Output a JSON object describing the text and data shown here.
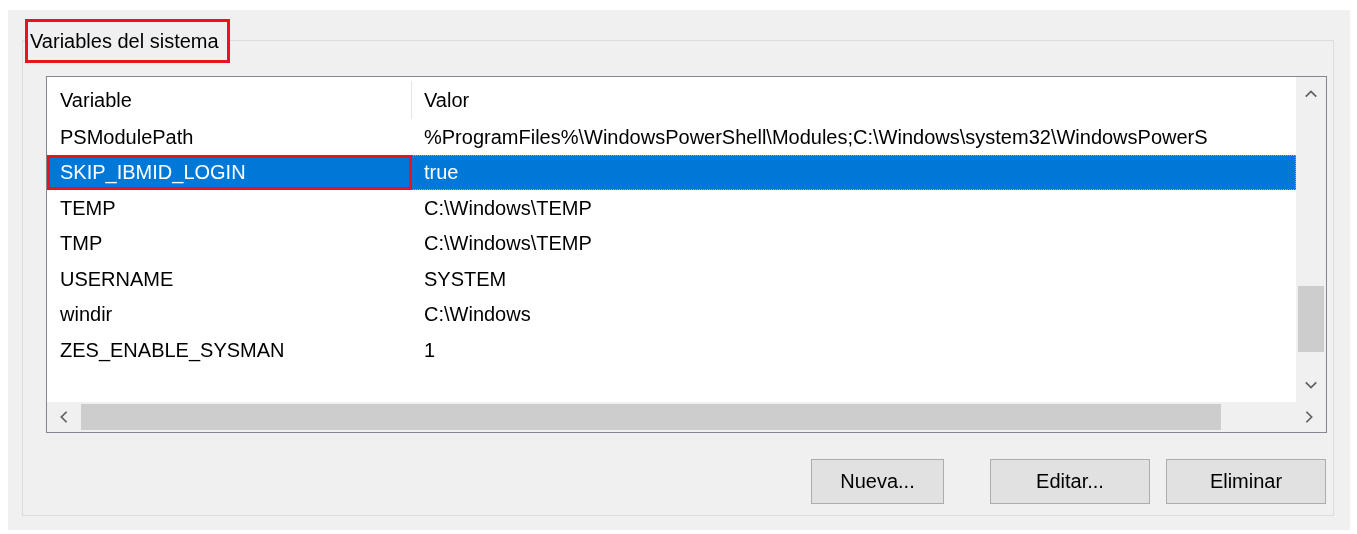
{
  "group": {
    "title": "Variables del sistema",
    "highlighted": true
  },
  "table": {
    "columns": [
      "Variable",
      "Valor"
    ],
    "rows": [
      {
        "variable": "PSModulePath",
        "value": "%ProgramFiles%\\WindowsPowerShell\\Modules;C:\\Windows\\system32\\WindowsPowerS",
        "selected": false,
        "highlighted": false
      },
      {
        "variable": "SKIP_IBMID_LOGIN",
        "value": "true",
        "selected": true,
        "highlighted": true
      },
      {
        "variable": "TEMP",
        "value": "C:\\Windows\\TEMP",
        "selected": false,
        "highlighted": false
      },
      {
        "variable": "TMP",
        "value": "C:\\Windows\\TEMP",
        "selected": false,
        "highlighted": false
      },
      {
        "variable": "USERNAME",
        "value": "SYSTEM",
        "selected": false,
        "highlighted": false
      },
      {
        "variable": "windir",
        "value": "C:\\Windows",
        "selected": false,
        "highlighted": false
      },
      {
        "variable": "ZES_ENABLE_SYSMAN",
        "value": "1",
        "selected": false,
        "highlighted": false
      }
    ]
  },
  "buttons": [
    "Nueva...",
    "Editar...",
    "Eliminar"
  ]
}
